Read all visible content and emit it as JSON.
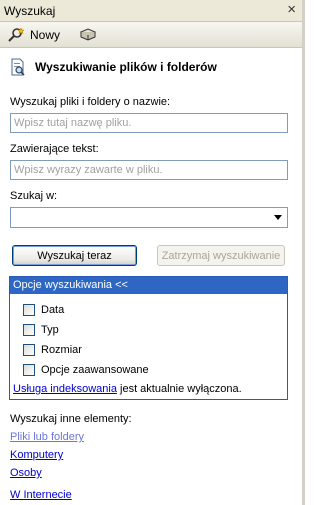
{
  "window": {
    "title": "Wyszukaj",
    "close_glyph": "×"
  },
  "toolbar": {
    "new_label": "Nowy"
  },
  "header": {
    "title": "Wyszukiwanie plików i folderów"
  },
  "form": {
    "name_label": "Wyszukaj pliki i foldery o nazwie:",
    "name_placeholder": "Wpisz tutaj nazwę pliku.",
    "text_label": "Zawierające tekst:",
    "text_placeholder": "Wpisz wyrazy zawarte w pliku.",
    "look_in_label": "Szukaj w:",
    "look_in_value": ""
  },
  "buttons": {
    "search_now": "Wyszukaj teraz",
    "stop_search": "Zatrzymaj wyszukiwanie"
  },
  "options": {
    "header": "Opcje wyszukiwania <<",
    "items": [
      {
        "label": "Data",
        "checked": false
      },
      {
        "label": "Typ",
        "checked": false
      },
      {
        "label": "Rozmiar",
        "checked": false
      },
      {
        "label": "Opcje zaawansowane",
        "checked": false
      }
    ],
    "indexing_link": "Usługa indeksowania",
    "indexing_status": " jest aktualnie wyłączona."
  },
  "more": {
    "label": "Wyszukaj inne elementy:",
    "links": [
      "Pliki lub foldery",
      "Komputery",
      "Osoby",
      "W Internecie"
    ]
  },
  "colors": {
    "accent": "#2d66c3",
    "link": "#0000cc",
    "disabled_link": "#6a77d6"
  },
  "icons": [
    "close-icon",
    "new-search-icon",
    "book-icon",
    "search-file-icon",
    "dropdown-arrow-icon"
  ]
}
